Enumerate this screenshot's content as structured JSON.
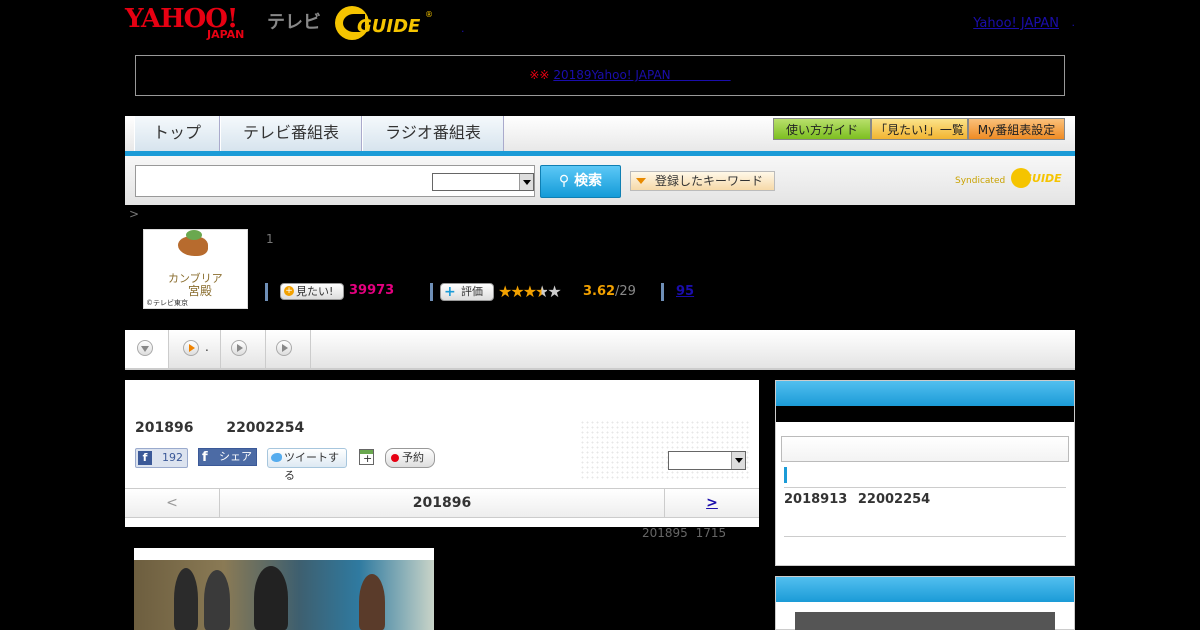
{
  "header": {
    "yahoo_logo": "YAHOO!",
    "yahoo_sub": "JAPAN",
    "tv_label": "テレビ",
    "gguide_logo": "GUIDE",
    "gguide_reg": "®",
    "dot_left": ".",
    "yahoo_japan_link": "Yahoo! JAPAN",
    "dot_right": "."
  },
  "notice": {
    "mark": "※※",
    "link_text": "20189Yahoo! JAPAN　　　　　"
  },
  "nav": {
    "tabs": [
      "トップ",
      "テレビ番組表",
      "ラジオ番組表"
    ],
    "right_buttons": [
      "使い方ガイド",
      "「見たい!」一覧",
      "My番組表設定"
    ]
  },
  "search": {
    "input_value": "",
    "placeholder": "",
    "select_value": "",
    "button_label": "検索",
    "keyword_button": "登録したキーワード",
    "syndicated_label": "Syndicated",
    "syndicated_logo": "GUIDE"
  },
  "breadcrumb": ">",
  "program": {
    "thumb_title_line1": "カンブリア",
    "thumb_title_line2": "宮殿",
    "thumb_credit": "©テレビ東京",
    "number": "1",
    "mitai_label": "見たい!",
    "mitai_count": "39973",
    "hyoka_label": "評価",
    "rating": "3.62",
    "rating_count": "/29",
    "rating_stars": 3.62,
    "reviews_link": "95"
  },
  "tabstrip": {
    "tab2_dot": "."
  },
  "episode": {
    "date": "201896",
    "time": "22002254",
    "fb_like_count": "192",
    "fb_share": "シェア",
    "tweet": "ツイートする",
    "reserve": "予約",
    "select_value": "",
    "nav_prev": "<",
    "nav_current": "201896",
    "nav_next": ">",
    "updated_date": "201895",
    "updated_time": "1715"
  },
  "sidebar": {
    "next_date": "2018913",
    "next_time": "22002254"
  },
  "colors": {
    "accent_blue": "#1b9bd7",
    "yahoo_red": "#e60012",
    "mitai_pink": "#e4007f",
    "star_orange": "#f2a100"
  }
}
